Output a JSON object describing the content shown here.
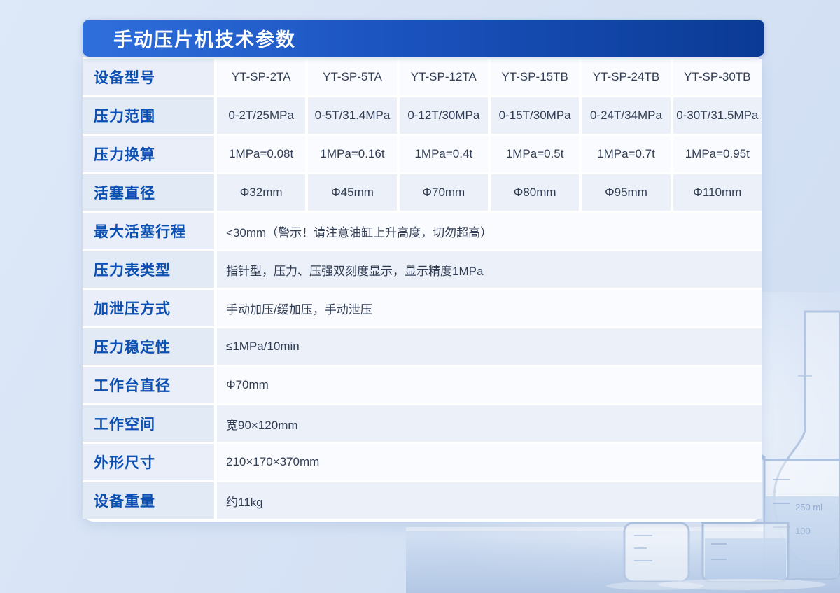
{
  "header": {
    "title": "手动压片机技术参数"
  },
  "colors": {
    "header_gradient_start": "#2f6fdc",
    "header_gradient_end": "#0a3a94",
    "label_text": "#0b4fb3",
    "value_text": "#323e55",
    "alt_row_bg": "#ecf1f9",
    "card_bg": "#ffffff",
    "page_bg": "#d7e3f5"
  },
  "background_icons": [
    "beaker-icon",
    "volumetric-flask-icon",
    "glass-bottle-icon"
  ],
  "rows": [
    {
      "label": "设备型号",
      "cells": [
        "YT-SP-2TA",
        "YT-SP-5TA",
        "YT-SP-12TA",
        "YT-SP-15TB",
        "YT-SP-24TB",
        "YT-SP-30TB"
      ]
    },
    {
      "label": "压力范围",
      "cells": [
        "0-2T/25MPa",
        "0-5T/31.4MPa",
        "0-12T/30MPa",
        "0-15T/30MPa",
        "0-24T/34MPa",
        "0-30T/31.5MPa"
      ]
    },
    {
      "label": "压力换算",
      "cells": [
        "1MPa=0.08t",
        "1MPa=0.16t",
        "1MPa=0.4t",
        "1MPa=0.5t",
        "1MPa=0.7t",
        "1MPa=0.95t"
      ]
    },
    {
      "label": "活塞直径",
      "cells": [
        "Φ32mm",
        "Φ45mm",
        "Φ70mm",
        "Φ80mm",
        "Φ95mm",
        "Φ110mm"
      ]
    },
    {
      "label": "最大活塞行程",
      "cells": [
        "<30mm（警示！请注意油缸上升高度，切勿超高）"
      ]
    },
    {
      "label": "压力表类型",
      "cells": [
        "指针型，压力、压强双刻度显示，显示精度1MPa"
      ]
    },
    {
      "label": "加泄压方式",
      "cells": [
        "手动加压/缓加压，手动泄压"
      ]
    },
    {
      "label": "压力稳定性",
      "cells": [
        "≤1MPa/10min"
      ]
    },
    {
      "label": "工作台直径",
      "cells": [
        "Φ70mm"
      ]
    },
    {
      "label": "工作空间",
      "cells": [
        "宽90×120mm"
      ]
    },
    {
      "label": "外形尺寸",
      "cells": [
        "210×170×370mm"
      ]
    },
    {
      "label": "设备重量",
      "cells": [
        "约11kg"
      ]
    }
  ]
}
